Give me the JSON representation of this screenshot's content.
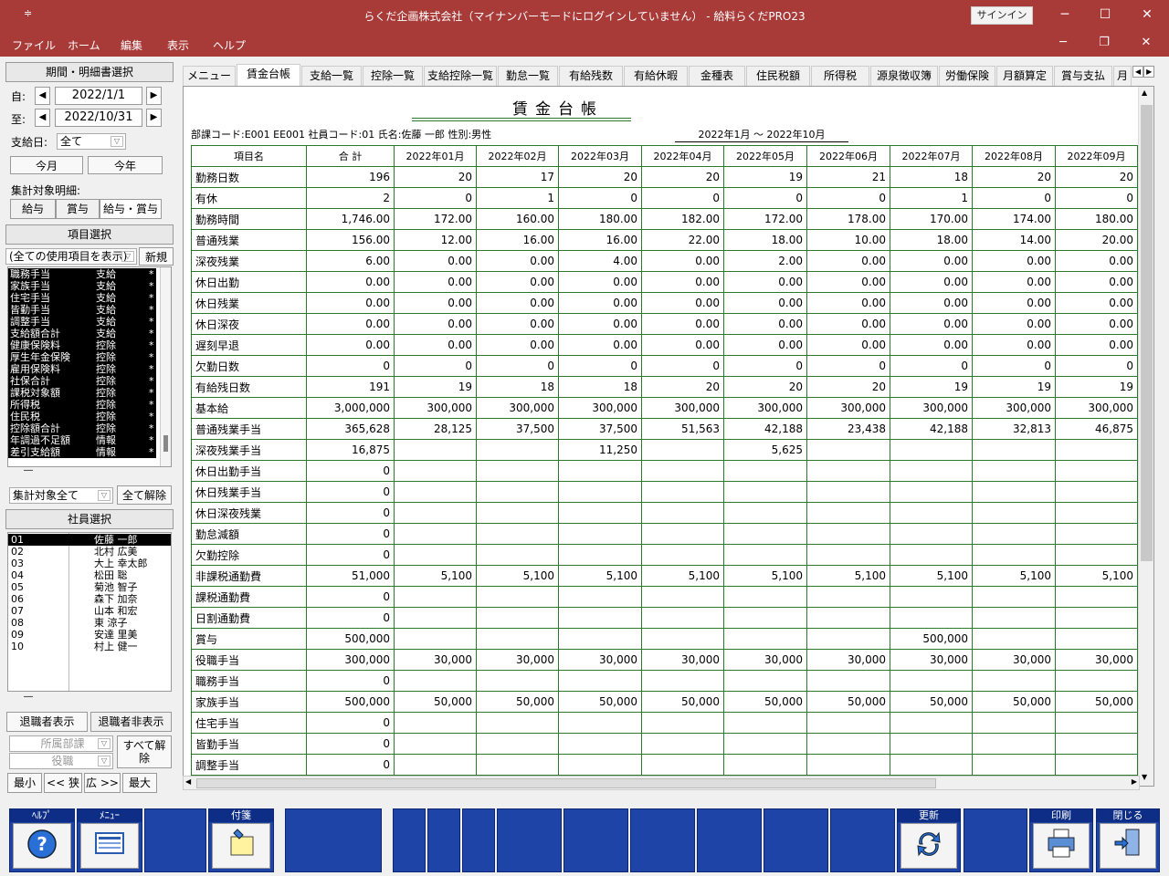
{
  "window": {
    "title": "らくだ企画株式会社（マイナンバーモードにログインしていません） -  給料らくだPRO23",
    "signin": "サインイン"
  },
  "menubar": [
    "ファイル",
    "ホーム",
    "編集",
    "表示",
    "ヘルプ"
  ],
  "left": {
    "period_header": "期間・明細書選択",
    "from_label": "自:",
    "from_value": "2022/1/1",
    "to_label": "至:",
    "to_value": "2022/10/31",
    "payday_label": "支給日:",
    "payday_value": "全て",
    "this_month": "今月",
    "this_year": "今年",
    "target_label": "集計対象明細:",
    "kyuyo": "給与",
    "shoyo": "賞与",
    "both": "給与・賞与",
    "item_header": "項目選択",
    "item_filter": "(全ての使用項目を表示)",
    "new_btn": "新規",
    "items": [
      {
        "name": "職務手当",
        "type": "支給",
        "mark": "*"
      },
      {
        "name": "家族手当",
        "type": "支給",
        "mark": "*"
      },
      {
        "name": "住宅手当",
        "type": "支給",
        "mark": "*"
      },
      {
        "name": "皆勤手当",
        "type": "支給",
        "mark": "*"
      },
      {
        "name": "調整手当",
        "type": "支給",
        "mark": "*"
      },
      {
        "name": "支給額合計",
        "type": "支給",
        "mark": "*"
      },
      {
        "name": "健康保険料",
        "type": "控除",
        "mark": "*"
      },
      {
        "name": "厚生年金保険",
        "type": "控除",
        "mark": "*"
      },
      {
        "name": "雇用保険料",
        "type": "控除",
        "mark": "*"
      },
      {
        "name": "社保合計",
        "type": "控除",
        "mark": "*"
      },
      {
        "name": "課税対象額",
        "type": "控除",
        "mark": "*"
      },
      {
        "name": "所得税",
        "type": "控除",
        "mark": "*"
      },
      {
        "name": "住民税",
        "type": "控除",
        "mark": "*"
      },
      {
        "name": "控除額合計",
        "type": "控除",
        "mark": "*"
      },
      {
        "name": "年調過不足額",
        "type": "情報",
        "mark": "*"
      },
      {
        "name": "差引支給額",
        "type": "情報",
        "mark": "*"
      }
    ],
    "dash": "―",
    "agg_filter": "集計対象全て",
    "clear_all": "全て解除",
    "emp_header": "社員選択",
    "employees": [
      {
        "code": "01",
        "name": "佐藤 一郎",
        "selected": true
      },
      {
        "code": "02",
        "name": "北村 広美"
      },
      {
        "code": "03",
        "name": "大上 幸太郎"
      },
      {
        "code": "04",
        "name": "松田 聡"
      },
      {
        "code": "05",
        "name": "菊池 智子"
      },
      {
        "code": "06",
        "name": "森下 加奈"
      },
      {
        "code": "07",
        "name": "山本 和宏"
      },
      {
        "code": "08",
        "name": "東 涼子"
      },
      {
        "code": "09",
        "name": "安達 里美"
      },
      {
        "code": "10",
        "name": "村上 健一"
      }
    ],
    "show_retired": "退職者表示",
    "hide_retired": "退職者非表示",
    "dept_placeholder": "所属部課",
    "post_placeholder": "役職",
    "clear_all2": "すべて解除",
    "min": "最小",
    "narrow": "<< 狭",
    "wide": "広 >>",
    "max": "最大"
  },
  "tabs": [
    "メニュー",
    "賃金台帳",
    "支給一覧",
    "控除一覧",
    "支給控除一覧",
    "勤怠一覧",
    "有給残数",
    "有給休暇",
    "金種表",
    "住民税額",
    "所得税",
    "源泉徴収簿",
    "労働保険",
    "月額算定",
    "賞与支払",
    "月"
  ],
  "active_tab": 1,
  "ledger": {
    "title": "賃金台帳",
    "info": "部課コード:E001 EE001 社員コード:01 氏名:佐藤 一郎 性別:男性",
    "period": "2022年1月 ～ 2022年10月",
    "columns": [
      "項目名",
      "合 計",
      "2022年01月",
      "2022年02月",
      "2022年03月",
      "2022年04月",
      "2022年05月",
      "2022年06月",
      "2022年07月",
      "2022年08月",
      "2022年09月"
    ],
    "rows": [
      [
        "勤務日数",
        "196",
        "20",
        "17",
        "20",
        "20",
        "19",
        "21",
        "18",
        "20",
        "20"
      ],
      [
        "有休",
        "2",
        "0",
        "1",
        "0",
        "0",
        "0",
        "0",
        "1",
        "0",
        "0"
      ],
      [
        "勤務時間",
        "1,746.00",
        "172.00",
        "160.00",
        "180.00",
        "182.00",
        "172.00",
        "178.00",
        "170.00",
        "174.00",
        "180.00"
      ],
      [
        "普通残業",
        "156.00",
        "12.00",
        "16.00",
        "16.00",
        "22.00",
        "18.00",
        "10.00",
        "18.00",
        "14.00",
        "20.00"
      ],
      [
        "深夜残業",
        "6.00",
        "0.00",
        "0.00",
        "4.00",
        "0.00",
        "2.00",
        "0.00",
        "0.00",
        "0.00",
        "0.00"
      ],
      [
        "休日出勤",
        "0.00",
        "0.00",
        "0.00",
        "0.00",
        "0.00",
        "0.00",
        "0.00",
        "0.00",
        "0.00",
        "0.00"
      ],
      [
        "休日残業",
        "0.00",
        "0.00",
        "0.00",
        "0.00",
        "0.00",
        "0.00",
        "0.00",
        "0.00",
        "0.00",
        "0.00"
      ],
      [
        "休日深夜",
        "0.00",
        "0.00",
        "0.00",
        "0.00",
        "0.00",
        "0.00",
        "0.00",
        "0.00",
        "0.00",
        "0.00"
      ],
      [
        "遅刻早退",
        "0.00",
        "0.00",
        "0.00",
        "0.00",
        "0.00",
        "0.00",
        "0.00",
        "0.00",
        "0.00",
        "0.00"
      ],
      [
        "欠勤日数",
        "0",
        "0",
        "0",
        "0",
        "0",
        "0",
        "0",
        "0",
        "0",
        "0"
      ],
      [
        "有給残日数",
        "191",
        "19",
        "18",
        "18",
        "20",
        "20",
        "20",
        "19",
        "19",
        "19"
      ],
      [
        "基本給",
        "3,000,000",
        "300,000",
        "300,000",
        "300,000",
        "300,000",
        "300,000",
        "300,000",
        "300,000",
        "300,000",
        "300,000"
      ],
      [
        "普通残業手当",
        "365,628",
        "28,125",
        "37,500",
        "37,500",
        "51,563",
        "42,188",
        "23,438",
        "42,188",
        "32,813",
        "46,875"
      ],
      [
        "深夜残業手当",
        "16,875",
        "",
        "",
        "11,250",
        "",
        "5,625",
        "",
        "",
        "",
        ""
      ],
      [
        "休日出勤手当",
        "0",
        "",
        "",
        "",
        "",
        "",
        "",
        "",
        "",
        ""
      ],
      [
        "休日残業手当",
        "0",
        "",
        "",
        "",
        "",
        "",
        "",
        "",
        "",
        ""
      ],
      [
        "休日深夜残業",
        "0",
        "",
        "",
        "",
        "",
        "",
        "",
        "",
        "",
        ""
      ],
      [
        "勤怠減額",
        "0",
        "",
        "",
        "",
        "",
        "",
        "",
        "",
        "",
        ""
      ],
      [
        "欠勤控除",
        "0",
        "",
        "",
        "",
        "",
        "",
        "",
        "",
        "",
        ""
      ],
      [
        "非課税通勤費",
        "51,000",
        "5,100",
        "5,100",
        "5,100",
        "5,100",
        "5,100",
        "5,100",
        "5,100",
        "5,100",
        "5,100"
      ],
      [
        "課税通勤費",
        "0",
        "",
        "",
        "",
        "",
        "",
        "",
        "",
        "",
        ""
      ],
      [
        "日割通勤費",
        "0",
        "",
        "",
        "",
        "",
        "",
        "",
        "",
        "",
        ""
      ],
      [
        "賞与",
        "500,000",
        "",
        "",
        "",
        "",
        "",
        "",
        "500,000",
        "",
        ""
      ],
      [
        "役職手当",
        "300,000",
        "30,000",
        "30,000",
        "30,000",
        "30,000",
        "30,000",
        "30,000",
        "30,000",
        "30,000",
        "30,000"
      ],
      [
        "職務手当",
        "0",
        "",
        "",
        "",
        "",
        "",
        "",
        "",
        "",
        ""
      ],
      [
        "家族手当",
        "500,000",
        "50,000",
        "50,000",
        "50,000",
        "50,000",
        "50,000",
        "50,000",
        "50,000",
        "50,000",
        "50,000"
      ],
      [
        "住宅手当",
        "0",
        "",
        "",
        "",
        "",
        "",
        "",
        "",
        "",
        ""
      ],
      [
        "皆勤手当",
        "0",
        "",
        "",
        "",
        "",
        "",
        "",
        "",
        "",
        ""
      ],
      [
        "調整手当",
        "0",
        "",
        "",
        "",
        "",
        "",
        "",
        "",
        "",
        ""
      ]
    ]
  },
  "fkeys": {
    "help": "ﾍﾙﾌﾟ",
    "menu": "ﾒﾆｭｰ",
    "fusen": "付箋",
    "update": "更新",
    "print": "印刷",
    "close": "閉じる"
  }
}
